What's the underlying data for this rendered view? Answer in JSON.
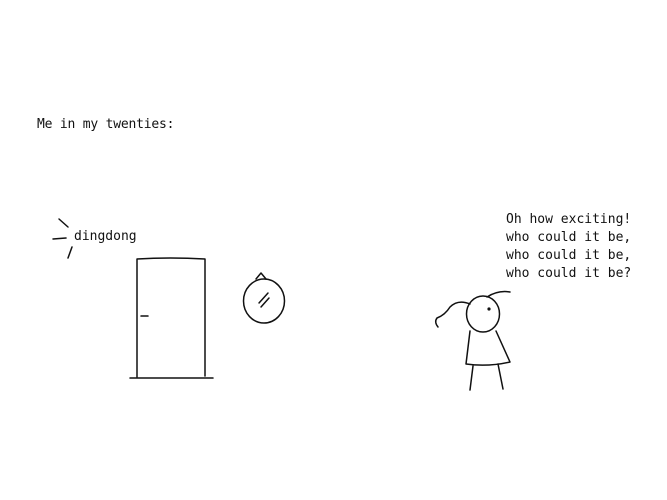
{
  "caption": "Me in my twenties:",
  "doorbell_sound": "dingdong",
  "speech_lines": [
    "Oh how exciting!",
    "who could it be,",
    "who could it be,",
    "who could it be?"
  ],
  "ink_color": "#111111",
  "background_color": "#ffffff"
}
